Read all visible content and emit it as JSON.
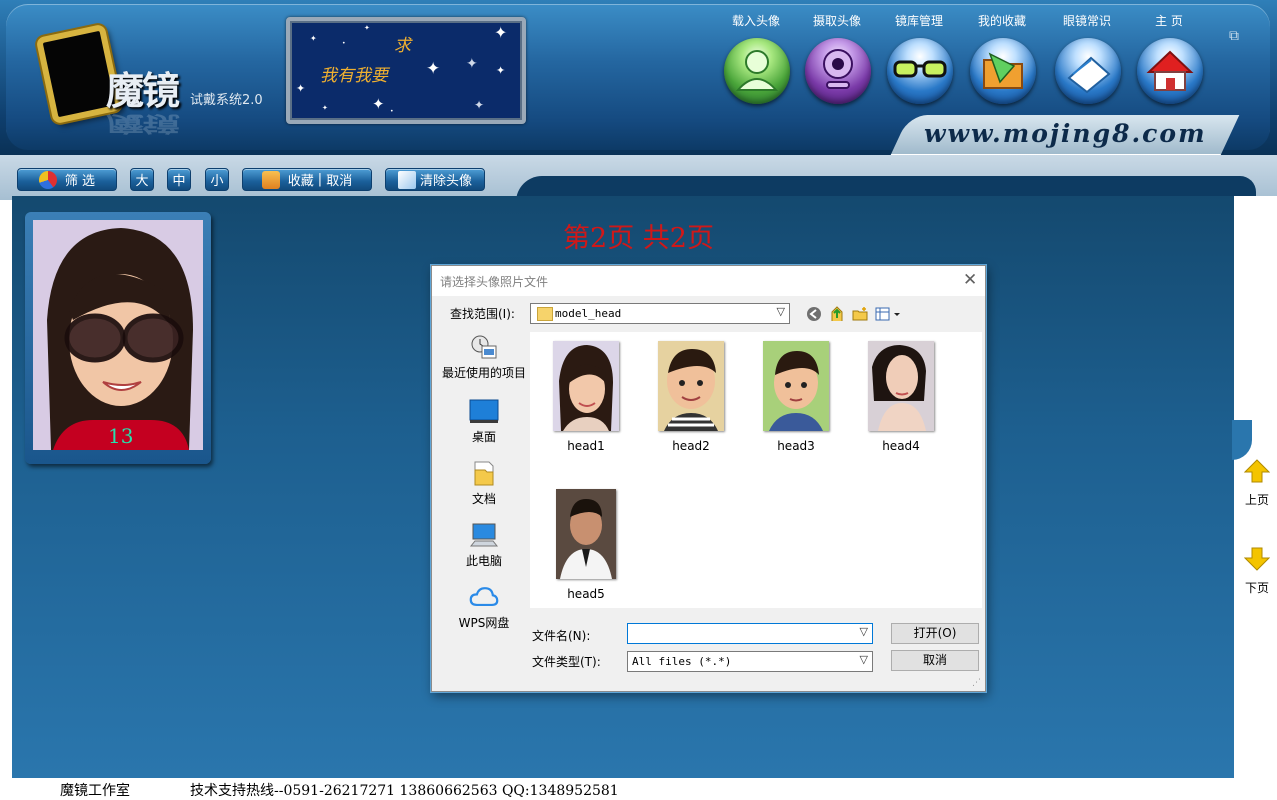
{
  "header": {
    "logo_text": "魔镜",
    "logo_subtitle": "试戴系统2.0",
    "banner_line1": "我有我要",
    "banner_line2": "求",
    "url": "www.mojing8.com",
    "nav": [
      {
        "label": "载入头像",
        "icon": "person-icon"
      },
      {
        "label": "摄取头像",
        "icon": "webcam-icon"
      },
      {
        "label": "镜库管理",
        "icon": "glasses-icon"
      },
      {
        "label": "我的收藏",
        "icon": "folder-icon"
      },
      {
        "label": "眼镜常识",
        "icon": "book-icon"
      },
      {
        "label": "主 页",
        "icon": "home-icon"
      }
    ]
  },
  "toolbar": {
    "filter_label": "筛 选",
    "size_large": "大",
    "size_medium": "中",
    "size_small": "小",
    "favorite_label": "收藏",
    "cancel_label": "取消",
    "clear_label": "清除头像"
  },
  "main": {
    "page_indicator": "第2页  共2页",
    "thumb_number": "13",
    "prev_page": "上页",
    "next_page": "下页"
  },
  "dialog": {
    "title": "请选择头像照片文件",
    "lookin_label": "查找范围(I):",
    "lookin_value": "model_head",
    "places": [
      "最近使用的项目",
      "桌面",
      "文档",
      "此电脑",
      "WPS网盘"
    ],
    "files": [
      "head1",
      "head2",
      "head3",
      "head4",
      "head5"
    ],
    "filename_label": "文件名(N):",
    "filename_value": "",
    "filetype_label": "文件类型(T):",
    "filetype_value": "All files (*.*)",
    "open_label": "打开(O)",
    "cancel_label": "取消"
  },
  "status": {
    "studio": "魔镜工作室",
    "support": "技术支持热线--0591-26217271 13860662563 QQ:1348952581"
  },
  "colors": {
    "page_indicator": "#d01818",
    "thumb_number": "#27e0ad",
    "banner_text": "#f0b030",
    "main_bg": "#1d5f8f"
  }
}
